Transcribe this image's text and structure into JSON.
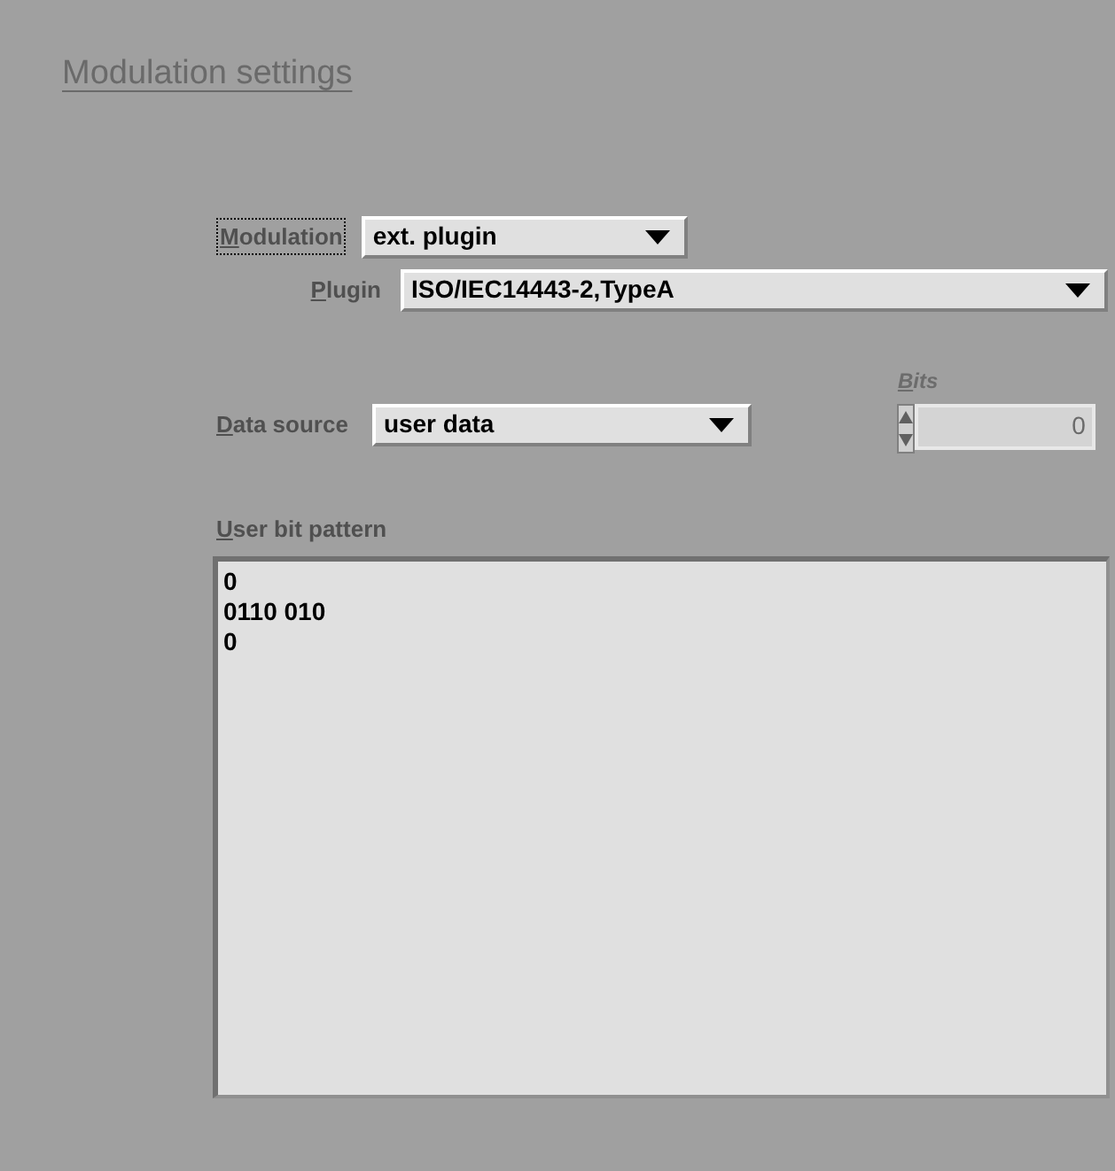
{
  "title": "Modulation settings",
  "modulation": {
    "label": "Modulation",
    "focused": true,
    "value": "ext. plugin"
  },
  "plugin": {
    "label": "Plugin",
    "focused": false,
    "value": "ISO/IEC14443-2,TypeA"
  },
  "data_source": {
    "label": "Data source",
    "focused": false,
    "value": "user data"
  },
  "bits": {
    "label": "Bits",
    "disabled": true,
    "value": "0"
  },
  "user_bit_pattern": {
    "label": "User bit pattern",
    "lines": [
      "0",
      "0110 010",
      "0"
    ]
  }
}
